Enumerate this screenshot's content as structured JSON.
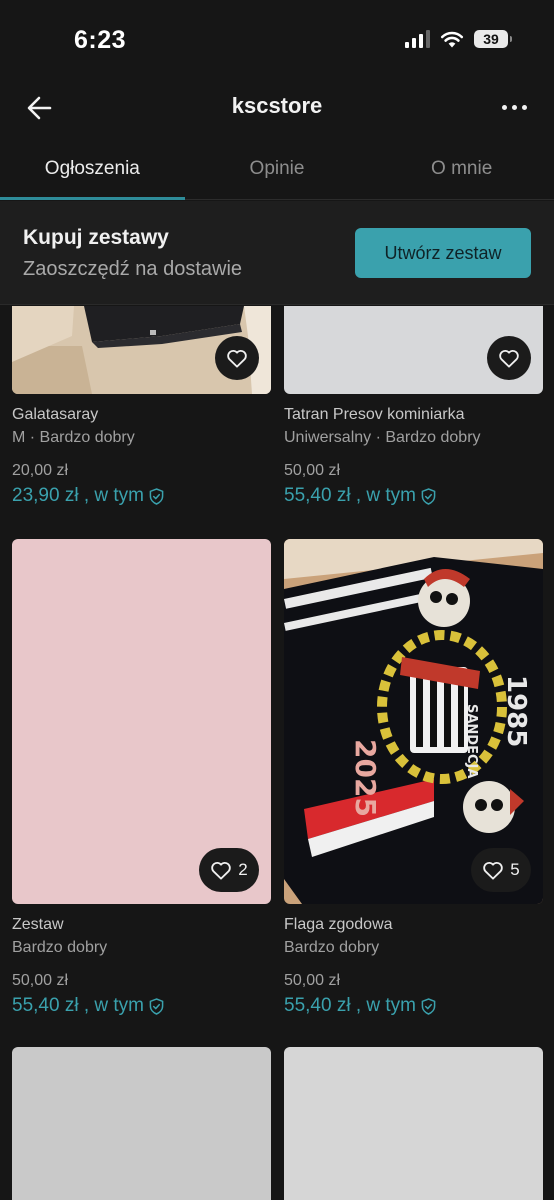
{
  "status": {
    "time": "6:23",
    "battery": "39"
  },
  "header": {
    "title": "kscstore"
  },
  "tabs": [
    {
      "label": "Ogłoszenia"
    },
    {
      "label": "Opinie"
    },
    {
      "label": "O mnie"
    }
  ],
  "bundle": {
    "title": "Kupuj zestawy",
    "subtitle": "Zaoszczędź na dostawie",
    "button": "Utwórz zestaw"
  },
  "listings": [
    {
      "title": "Galatasaray",
      "condition": "M · Bardzo dobry",
      "price": "20,00 zł",
      "total": "23,90 zł , w tym"
    },
    {
      "title": "Tatran Presov kominiarka",
      "condition": "Uniwersalny · Bardzo dobry",
      "price": "50,00 zł",
      "total": "55,40 zł , w tym"
    },
    {
      "title": "Zestaw",
      "condition": "Bardzo dobry",
      "price": "50,00 zł",
      "total": "55,40 zł , w tym",
      "likes": "2"
    },
    {
      "title": "Flaga zgodowa",
      "condition": "Bardzo dobry",
      "price": "50,00 zł",
      "total": "55,40 zł , w tym",
      "likes": "5"
    }
  ],
  "flag_artwork": {
    "year_left": "2025",
    "year_right": "1985",
    "band_text": "SANDECJA"
  },
  "colors": {
    "accent": "#3aa1ad",
    "background": "#161616",
    "pink_placeholder": "#e8c7ca",
    "gray_placeholder": "#d7d8da"
  }
}
